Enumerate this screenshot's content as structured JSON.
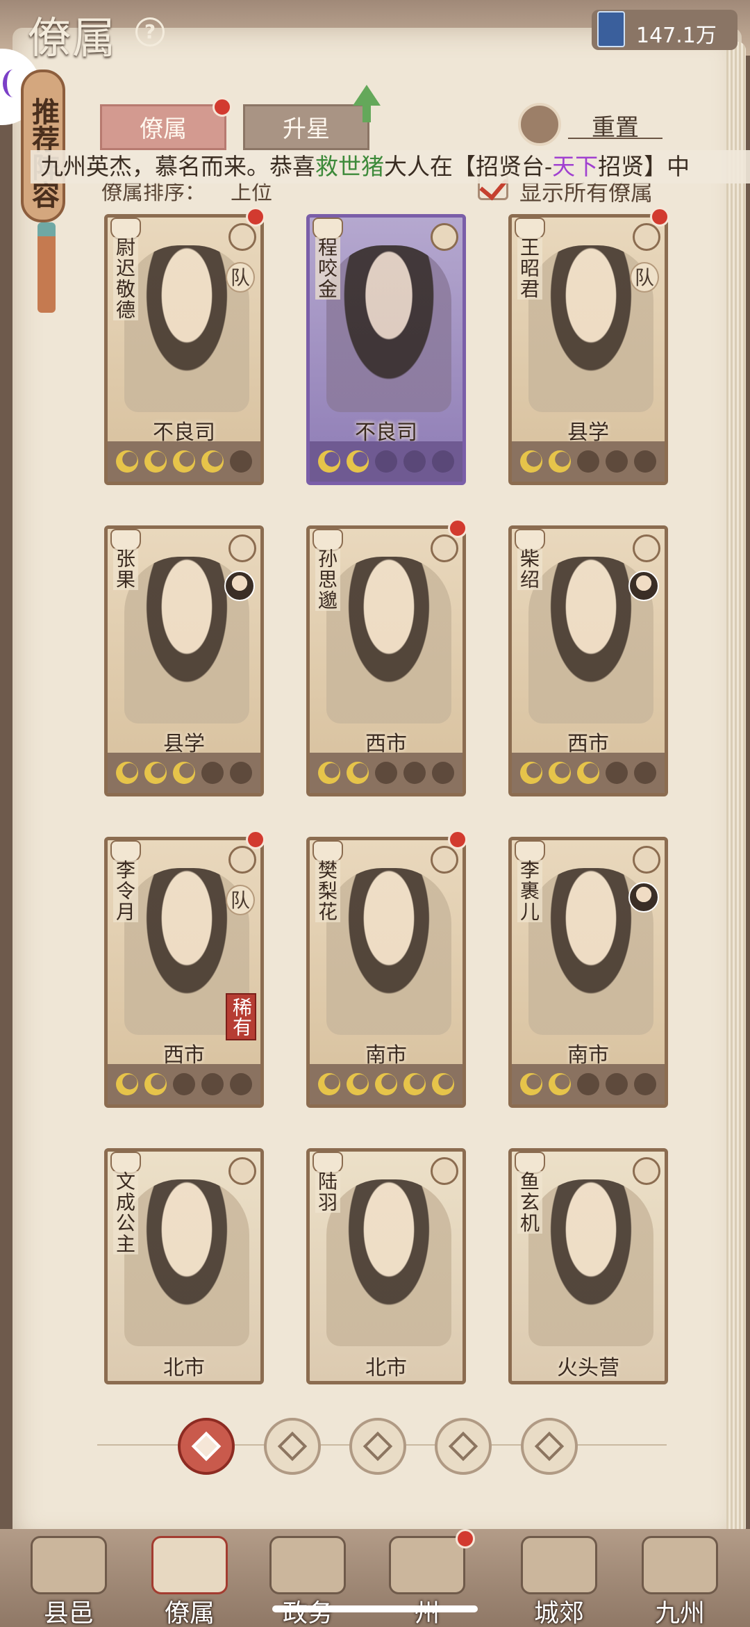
{
  "header": {
    "title": "僚属",
    "currency_value": "147.1万"
  },
  "recommend_tag": "推荐阵容",
  "tabs": [
    {
      "label": "僚属",
      "active": true,
      "has_dot": true
    },
    {
      "label": "升星",
      "active": false,
      "has_dot": false
    }
  ],
  "reset_label": "重置",
  "marquee": {
    "prefix": "九州英杰，慕名而来。恭喜",
    "player": "救世猪",
    "middle": "大人在【招贤台-",
    "place": "天下",
    "suffix": "招贤】中"
  },
  "sort": {
    "label": "僚属排序：",
    "value": "上位"
  },
  "show_all_label": "显示所有僚属",
  "cards": [
    {
      "name": "尉迟敬德",
      "location": "不良司",
      "stars": 4,
      "max": 5,
      "dot": true,
      "team": "队",
      "purple": false,
      "rare": ""
    },
    {
      "name": "程咬金",
      "location": "不良司",
      "stars": 2,
      "max": 5,
      "dot": false,
      "team": "",
      "purple": true,
      "rare": ""
    },
    {
      "name": "王昭君",
      "location": "县学",
      "stars": 2,
      "max": 5,
      "dot": true,
      "team": "队",
      "purple": false,
      "rare": ""
    },
    {
      "name": "张果",
      "location": "县学",
      "stars": 3,
      "max": 5,
      "dot": false,
      "team": "",
      "purple": false,
      "rare": "",
      "mini": true
    },
    {
      "name": "孙思邈",
      "location": "西市",
      "stars": 2,
      "max": 5,
      "dot": true,
      "team": "",
      "purple": false,
      "rare": ""
    },
    {
      "name": "柴绍",
      "location": "西市",
      "stars": 3,
      "max": 5,
      "dot": false,
      "team": "",
      "purple": false,
      "rare": "",
      "mini": true
    },
    {
      "name": "李令月",
      "location": "西市",
      "stars": 2,
      "max": 5,
      "dot": true,
      "team": "队",
      "purple": false,
      "rare": "稀有"
    },
    {
      "name": "樊梨花",
      "location": "南市",
      "stars": 5,
      "max": 5,
      "dot": true,
      "team": "",
      "purple": false,
      "rare": ""
    },
    {
      "name": "李裹儿",
      "location": "南市",
      "stars": 2,
      "max": 5,
      "dot": false,
      "team": "",
      "purple": false,
      "rare": "",
      "mini": true
    },
    {
      "name": "文成公主",
      "location": "北市",
      "stars": 0,
      "max": 0,
      "dot": false,
      "team": "",
      "purple": false,
      "rare": "",
      "locked": true
    },
    {
      "name": "陆羽",
      "location": "北市",
      "stars": 0,
      "max": 0,
      "dot": false,
      "team": "",
      "purple": false,
      "rare": "",
      "locked": true
    },
    {
      "name": "鱼玄机",
      "location": "火头营",
      "stars": 0,
      "max": 0,
      "dot": false,
      "team": "",
      "purple": false,
      "rare": "",
      "locked": true
    }
  ],
  "bottom_nav": [
    {
      "label": "县邑",
      "active": false,
      "dot": false
    },
    {
      "label": "僚属",
      "active": true,
      "dot": false
    },
    {
      "label": "政务",
      "active": false,
      "dot": false
    },
    {
      "label": "州",
      "active": false,
      "dot": true
    },
    {
      "label": "城郊",
      "active": false,
      "dot": false
    },
    {
      "label": "九州",
      "active": false,
      "dot": false
    }
  ],
  "colors": {
    "accent_red": "#d23a2f",
    "star_gold": "#e6c44a",
    "rare_red": "#b63d33"
  }
}
